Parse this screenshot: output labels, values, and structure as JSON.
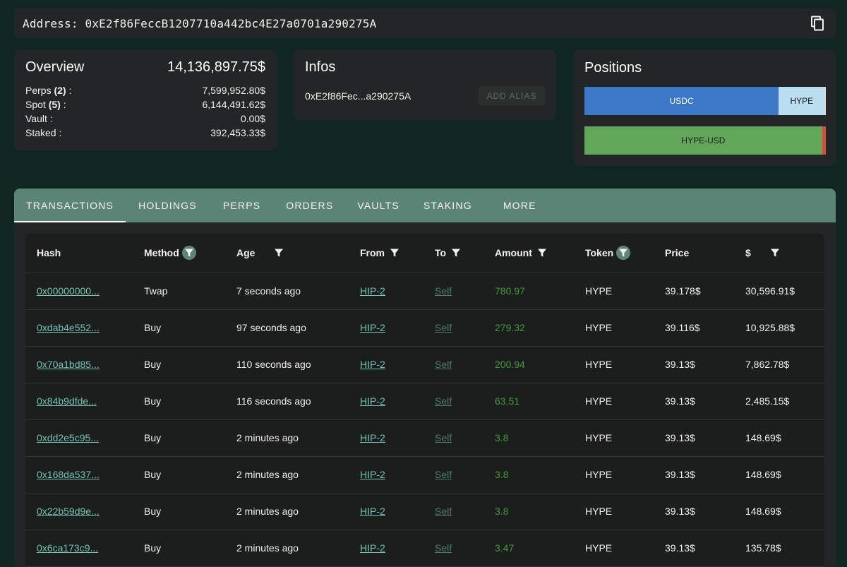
{
  "address_bar": {
    "text": "Address: 0xE2f86FeccB1207710a442bc4E27a0701a290275A"
  },
  "overview": {
    "title": "Overview",
    "total": "14,136,897.75$",
    "rows": [
      {
        "label": "Perps",
        "count": "(2)",
        "colon": " :",
        "value": "7,599,952.80$"
      },
      {
        "label": "Spot",
        "count": "(5)",
        "colon": " :",
        "value": "6,144,491.62$"
      },
      {
        "label": "Vault :",
        "count": "",
        "colon": "",
        "value": "0.00$"
      },
      {
        "label": "Staked :",
        "count": "",
        "colon": "",
        "value": "392,453.33$"
      }
    ]
  },
  "infos": {
    "title": "Infos",
    "short_address": "0xE2f86Fec...a290275A",
    "alias_button": "ADD ALIAS"
  },
  "positions": {
    "title": "Positions",
    "bar1": [
      {
        "label": "USDC",
        "share": 0.805,
        "color": "#3d77c8",
        "text_color": "#ffffff"
      },
      {
        "label": "HYPE",
        "share": 0.19,
        "color": "#b9dff1",
        "text_color": "#1b1b1b"
      },
      {
        "label": "",
        "share": 0.005,
        "color": "#dcdcdc",
        "text_color": "#000000"
      }
    ],
    "bar2": [
      {
        "label": "HYPE-USD",
        "share": 0.985,
        "color": "#62a659",
        "text_color": "#1b1b1b"
      },
      {
        "label": "",
        "share": 0.015,
        "color": "#d94a3a",
        "text_color": "#000000"
      }
    ]
  },
  "tabs": [
    "TRANSACTIONS",
    "HOLDINGS",
    "PERPS",
    "ORDERS",
    "VAULTS",
    "STAKING",
    "MORE"
  ],
  "table": {
    "columns": [
      "Hash",
      "Method",
      "Age",
      "From",
      "To",
      "Amount",
      "Token",
      "Price",
      "$"
    ],
    "rows": [
      {
        "hash": "0x00000000...",
        "method": "Twap",
        "age": "7 seconds ago",
        "from": "HIP-2",
        "to": "Self",
        "amount": "780.97",
        "token": "HYPE",
        "price": "39.178$",
        "usd": "30,596.91$"
      },
      {
        "hash": "0xdab4e552...",
        "method": "Buy",
        "age": "97 seconds ago",
        "from": "HIP-2",
        "to": "Self",
        "amount": "279.32",
        "token": "HYPE",
        "price": "39.116$",
        "usd": "10,925.88$"
      },
      {
        "hash": "0x70a1bd85...",
        "method": "Buy",
        "age": "110 seconds ago",
        "from": "HIP-2",
        "to": "Self",
        "amount": "200.94",
        "token": "HYPE",
        "price": "39.13$",
        "usd": "7,862.78$"
      },
      {
        "hash": "0x84b9dfde...",
        "method": "Buy",
        "age": "116 seconds ago",
        "from": "HIP-2",
        "to": "Self",
        "amount": "63.51",
        "token": "HYPE",
        "price": "39.13$",
        "usd": "2,485.15$"
      },
      {
        "hash": "0xdd2e5c95...",
        "method": "Buy",
        "age": "2 minutes ago",
        "from": "HIP-2",
        "to": "Self",
        "amount": "3.8",
        "token": "HYPE",
        "price": "39.13$",
        "usd": "148.69$"
      },
      {
        "hash": "0x168da537...",
        "method": "Buy",
        "age": "2 minutes ago",
        "from": "HIP-2",
        "to": "Self",
        "amount": "3.8",
        "token": "HYPE",
        "price": "39.13$",
        "usd": "148.69$"
      },
      {
        "hash": "0x22b59d9e...",
        "method": "Buy",
        "age": "2 minutes ago",
        "from": "HIP-2",
        "to": "Self",
        "amount": "3.8",
        "token": "HYPE",
        "price": "39.13$",
        "usd": "148.69$"
      },
      {
        "hash": "0x6ca173c9...",
        "method": "Buy",
        "age": "2 minutes ago",
        "from": "HIP-2",
        "to": "Self",
        "amount": "3.47",
        "token": "HYPE",
        "price": "39.13$",
        "usd": "135.78$"
      }
    ]
  },
  "colors": {
    "background": "#0f2621",
    "card": "#232626",
    "tabs": "#5d8577",
    "link": "#71c5b2",
    "amount": "#3f9d38"
  }
}
